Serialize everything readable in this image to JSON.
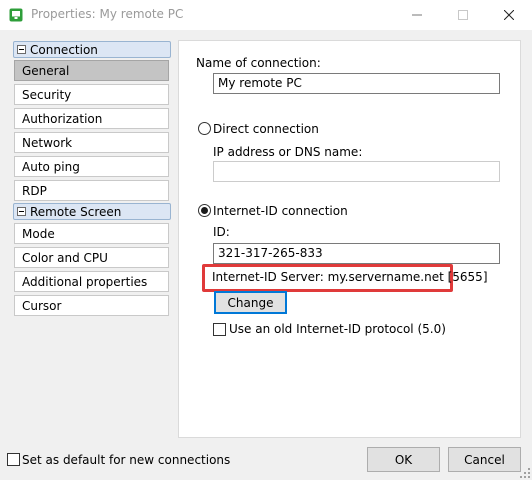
{
  "window": {
    "title": "Properties: My remote PC",
    "icon": "app-monitor-icon",
    "accent": "#0078d7"
  },
  "sidebar": {
    "sections": [
      {
        "label": "Connection",
        "items": [
          "General",
          "Security",
          "Authorization",
          "Network",
          "Auto ping",
          "RDP"
        ]
      },
      {
        "label": "Remote Screen",
        "items": [
          "Mode",
          "Color and CPU",
          "Additional properties",
          "Cursor"
        ]
      }
    ],
    "selected_item": "General"
  },
  "general": {
    "name_label": "Name of connection:",
    "name_value": "My remote PC",
    "direct_label": "Direct connection",
    "direct_checked": false,
    "ip_label": "IP address or DNS name:",
    "ip_value": "",
    "internet_id_label": "Internet-ID connection",
    "internet_id_checked": true,
    "id_label": "ID:",
    "id_value": "321-317-265-833",
    "server_text": "Internet-ID Server: my.servername.net [5655]",
    "highlight_color": "#e03a3a",
    "change_label": "Change",
    "old_protocol_label": "Use an old Internet-ID protocol (5.0)",
    "old_protocol_checked": false
  },
  "footer": {
    "default_label": "Set as default for new connections",
    "default_checked": false,
    "ok_label": "OK",
    "cancel_label": "Cancel"
  }
}
